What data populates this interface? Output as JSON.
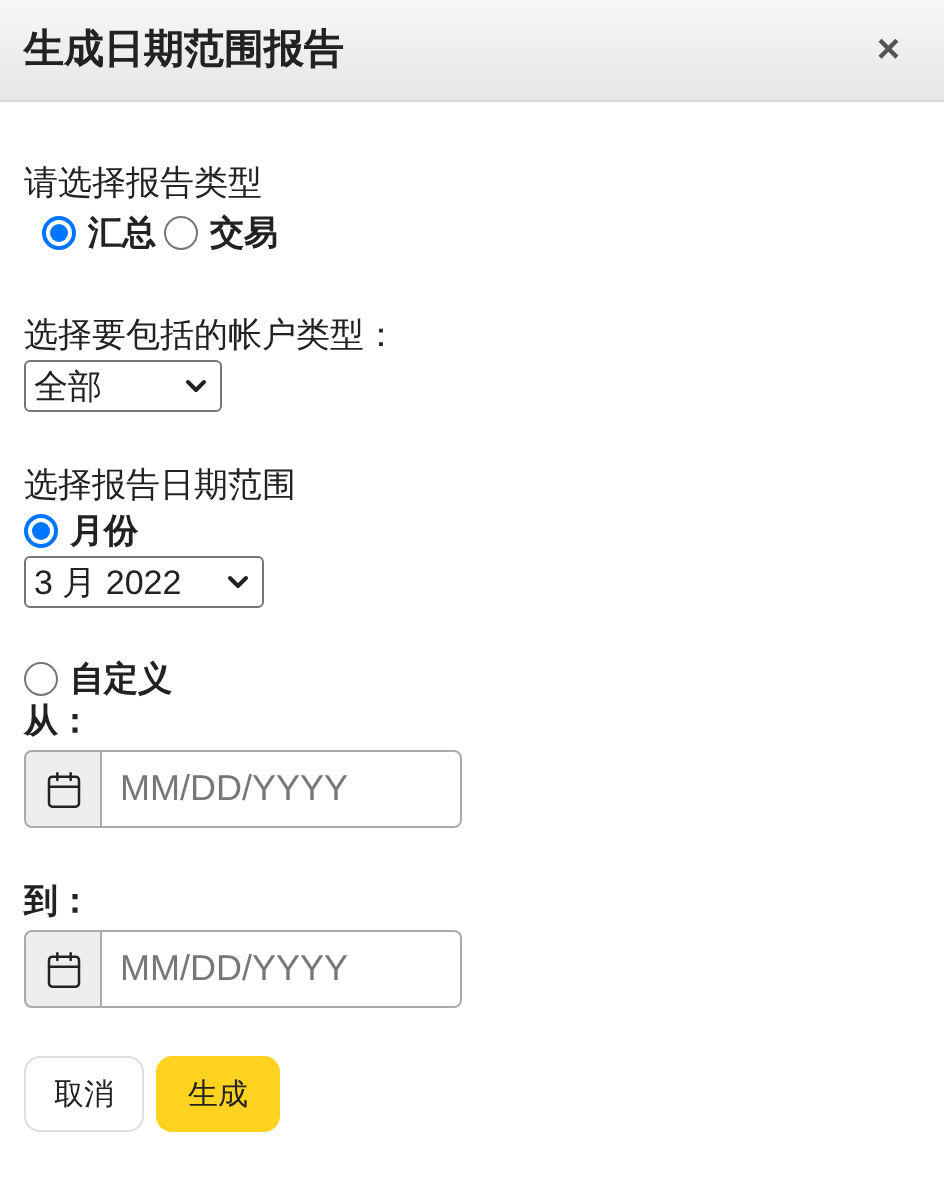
{
  "dialog": {
    "title": "生成日期范围报告",
    "close": "×"
  },
  "report_type": {
    "label": "请选择报告类型",
    "options": [
      {
        "label": "汇总",
        "selected": true
      },
      {
        "label": "交易",
        "selected": false
      }
    ]
  },
  "account_type": {
    "label": "选择要包括的帐户类型：",
    "value": "全部"
  },
  "date_range": {
    "label": "选择报告日期范围",
    "month": {
      "label": "月份",
      "selected": true,
      "value": "3 月 2022"
    },
    "custom": {
      "label": "自定义",
      "selected": false,
      "fields": [
        {
          "label": "从：",
          "placeholder": "MM/DD/YYYY"
        },
        {
          "label": "到：",
          "placeholder": "MM/DD/YYYY"
        }
      ]
    }
  },
  "buttons": [
    {
      "label": "取消",
      "kind": "secondary"
    },
    {
      "label": "生成",
      "kind": "primary"
    }
  ]
}
